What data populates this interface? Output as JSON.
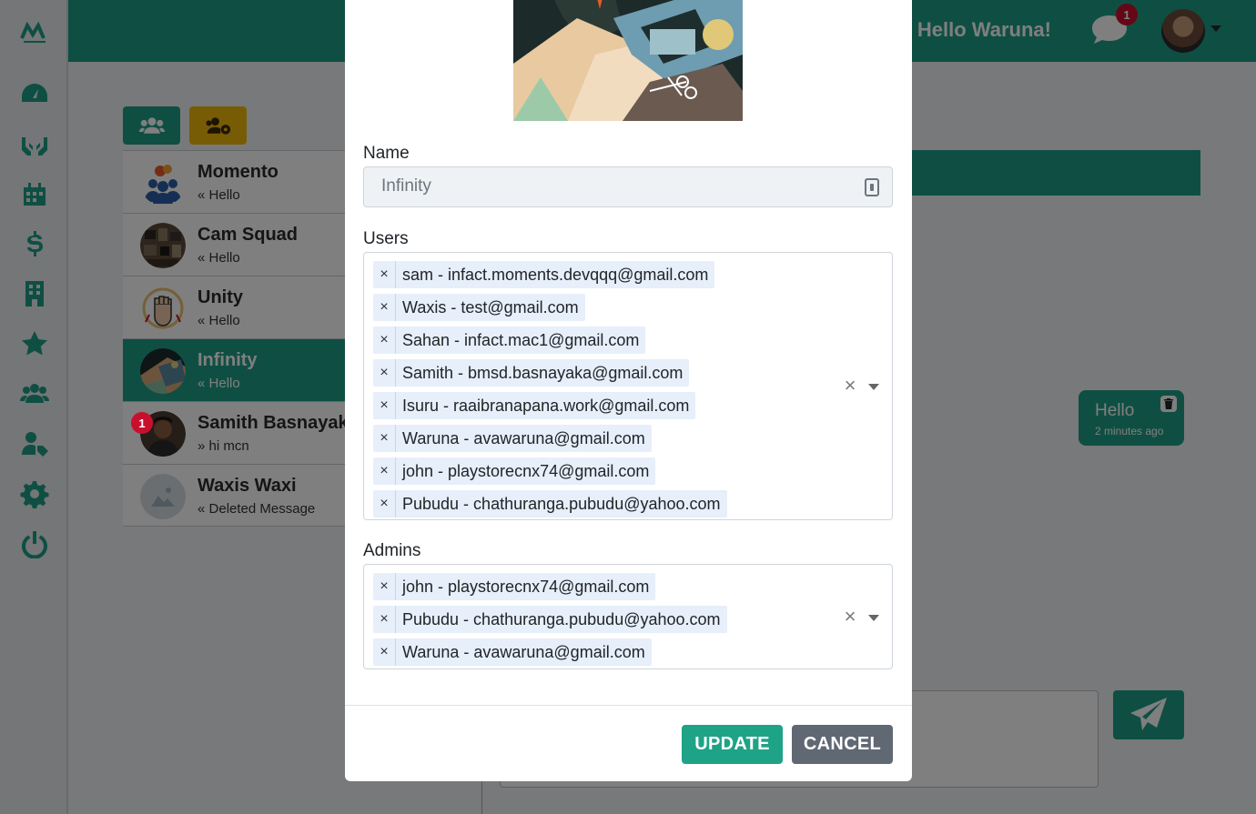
{
  "header": {
    "greeting": "Hello Waruna!",
    "notification_count": "1"
  },
  "sidebar": {
    "items": [
      {
        "icon": "dashboard-icon"
      },
      {
        "icon": "hands-icon"
      },
      {
        "icon": "calendar-icon"
      },
      {
        "icon": "dollar-icon"
      },
      {
        "icon": "building-icon"
      },
      {
        "icon": "star-icon"
      },
      {
        "icon": "users-icon"
      },
      {
        "icon": "user-tag-icon"
      },
      {
        "icon": "gear-icon"
      },
      {
        "icon": "power-icon"
      }
    ]
  },
  "groups": [
    {
      "name": "Momento",
      "last": "Hello",
      "direction": "«"
    },
    {
      "name": "Cam Squad",
      "last": "Hello",
      "direction": "«"
    },
    {
      "name": "Unity",
      "last": "Hello",
      "direction": "«"
    },
    {
      "name": "Infinity",
      "last": "Hello",
      "direction": "«"
    },
    {
      "name": "Samith Basnayaka",
      "last": "hi mcn",
      "direction": "»",
      "badge": "1"
    },
    {
      "name": "Waxis Waxi",
      "last": "Deleted Message",
      "direction": "«"
    }
  ],
  "chat": {
    "message_text": "Hello",
    "message_time": "2 minutes ago"
  },
  "modal": {
    "name_label": "Name",
    "name_placeholder": "Infinity",
    "users_label": "Users",
    "users": [
      "sam - infact.moments.devqqq@gmail.com",
      "Waxis - test@gmail.com",
      "Sahan - infact.mac1@gmail.com",
      "Samith - bmsd.basnayaka@gmail.com",
      "Isuru - raaibranapana.work@gmail.com",
      "Waruna - avawaruna@gmail.com",
      "john - playstorecnx74@gmail.com",
      "Pubudu - chathuranga.pubudu@yahoo.com"
    ],
    "admins_label": "Admins",
    "admins": [
      "john - playstorecnx74@gmail.com",
      "Pubudu - chathuranga.pubudu@yahoo.com",
      "Waruna - avawaruna@gmail.com"
    ],
    "remove_symbol": "×",
    "update_label": "UPDATE",
    "cancel_label": "CANCEL"
  },
  "colors": {
    "brand": "#1e9e86",
    "accent_yellow": "#f0b90b",
    "badge_red": "#c8102e",
    "cancel_gray": "#5f6873",
    "tag_bg": "#e6effa"
  }
}
